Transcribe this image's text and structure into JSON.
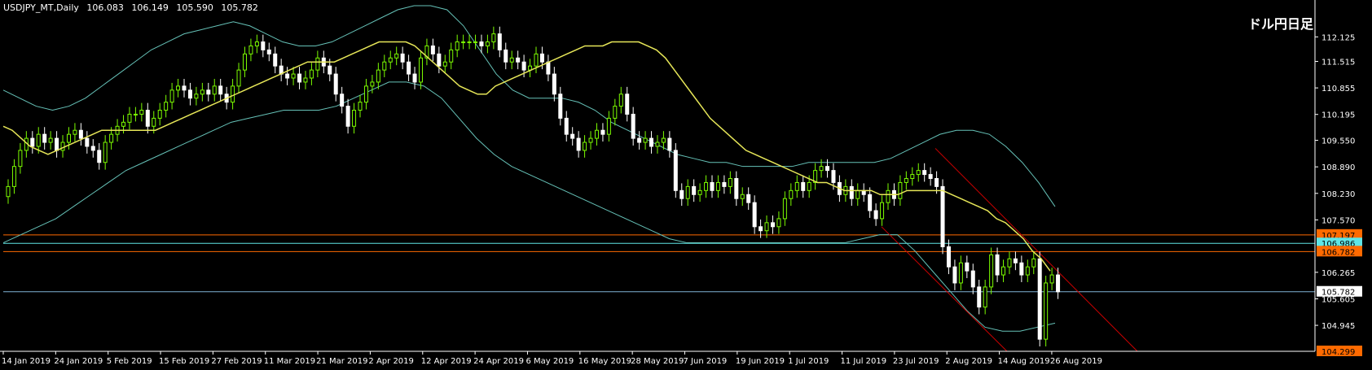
{
  "header": {
    "symbol": "USDJPY_MT,Daily",
    "open": "106.083",
    "high": "106.149",
    "low": "105.590",
    "close": "105.782"
  },
  "title_jp": "ドル円日足",
  "colors": {
    "background": "#000000",
    "bull_candle": "#7CFC00",
    "bear_candle": "#FFFFFF",
    "ma_line": "#E6E658",
    "bands": "#66C2B8",
    "orange_line": "#FF6A00",
    "cyan_line": "#5FE6E6",
    "channel": "#CC0000",
    "axis": "#FFFFFF"
  },
  "chart_data": {
    "type": "candlestick",
    "ylim": [
      104.299,
      112.8
    ],
    "y_ticks": [
      "112.125",
      "111.515",
      "110.855",
      "110.195",
      "109.550",
      "108.890",
      "108.230",
      "107.570",
      "106.265",
      "105.605",
      "104.945"
    ],
    "x_ticks": [
      "14 Jan 2019",
      "24 Jan 2019",
      "5 Feb 2019",
      "15 Feb 2019",
      "27 Feb 2019",
      "11 Mar 2019",
      "21 Mar 2019",
      "2 Apr 2019",
      "12 Apr 2019",
      "24 Apr 2019",
      "6 May 2019",
      "16 May 2019",
      "28 May 2019",
      "7 Jun 2019",
      "19 Jun 2019",
      "1 Jul 2019",
      "11 Jul 2019",
      "23 Jul 2019",
      "2 Aug 2019",
      "14 Aug 2019",
      "26 Aug 2019"
    ],
    "price_labels": [
      {
        "value": 107.197,
        "label": "107.197",
        "bg": "#FF6A00",
        "fg": "#000000"
      },
      {
        "value": 106.986,
        "label": "106.986",
        "bg": "#5FE6E6",
        "fg": "#000000"
      },
      {
        "value": 106.782,
        "label": "106.782",
        "bg": "#FF6A00",
        "fg": "#000000"
      },
      {
        "value": 105.782,
        "label": "105.782",
        "bg": "#FFFFFF",
        "fg": "#000000"
      },
      {
        "value": 104.299,
        "label": "104.299",
        "bg": "#FF6A00",
        "fg": "#000000"
      }
    ],
    "h_lines": [
      {
        "value": 107.197,
        "color": "#FF6A00"
      },
      {
        "value": 106.986,
        "color": "#5FE6E6"
      },
      {
        "value": 106.782,
        "color": "#FF6A00"
      },
      {
        "value": 105.782,
        "color": "#7FB3D5"
      },
      {
        "value": 104.299,
        "color": "#FF6A00"
      }
    ],
    "closes": [
      108.4,
      108.9,
      109.3,
      109.6,
      109.4,
      109.7,
      109.5,
      109.6,
      109.3,
      109.5,
      109.7,
      109.8,
      109.6,
      109.4,
      109.3,
      109.0,
      109.5,
      109.7,
      109.9,
      110.0,
      110.2,
      110.2,
      110.3,
      109.9,
      110.1,
      110.3,
      110.5,
      110.8,
      110.9,
      110.8,
      110.6,
      110.7,
      110.8,
      110.7,
      110.9,
      110.7,
      110.5,
      110.9,
      111.3,
      111.7,
      111.9,
      112.0,
      111.8,
      111.7,
      111.4,
      111.2,
      111.1,
      111.2,
      111.0,
      111.1,
      111.3,
      111.6,
      111.4,
      111.2,
      110.7,
      110.4,
      109.9,
      110.3,
      110.5,
      110.9,
      111.0,
      111.3,
      111.5,
      111.6,
      111.7,
      111.5,
      111.2,
      111.0,
      111.6,
      111.9,
      111.7,
      111.4,
      111.5,
      111.8,
      112.0,
      112.0,
      112.0,
      112.0,
      111.9,
      112.0,
      112.2,
      111.8,
      111.5,
      111.6,
      111.5,
      111.3,
      111.4,
      111.7,
      111.5,
      111.2,
      110.7,
      110.1,
      109.7,
      109.6,
      109.3,
      109.5,
      109.6,
      109.8,
      109.7,
      110.1,
      110.4,
      110.7,
      110.2,
      109.6,
      109.5,
      109.6,
      109.4,
      109.5,
      109.6,
      109.3,
      108.3,
      108.1,
      108.4,
      108.2,
      108.3,
      108.5,
      108.3,
      108.5,
      108.4,
      108.6,
      108.1,
      108.2,
      108.0,
      107.4,
      107.3,
      107.5,
      107.4,
      107.6,
      108.1,
      108.3,
      108.5,
      108.3,
      108.5,
      108.8,
      108.9,
      108.8,
      108.5,
      108.2,
      108.4,
      108.1,
      108.3,
      108.2,
      107.8,
      107.6,
      108.0,
      108.3,
      108.1,
      108.5,
      108.6,
      108.7,
      108.8,
      108.7,
      108.6,
      108.4,
      106.9,
      106.4,
      106.0,
      106.5,
      106.3,
      105.9,
      105.4,
      105.9,
      106.7,
      106.2,
      106.4,
      106.6,
      106.5,
      106.2,
      106.4,
      106.6,
      104.6,
      106.0,
      106.2,
      105.78
    ],
    "ma": [
      109.9,
      109.8,
      109.6,
      109.4,
      109.3,
      109.2,
      109.3,
      109.4,
      109.5,
      109.6,
      109.7,
      109.8,
      109.8,
      109.8,
      109.8,
      109.8,
      109.8,
      109.8,
      109.9,
      110.0,
      110.1,
      110.2,
      110.3,
      110.4,
      110.5,
      110.6,
      110.7,
      110.8,
      110.9,
      111.0,
      111.1,
      111.2,
      111.3,
      111.4,
      111.5,
      111.5,
      111.5,
      111.5,
      111.6,
      111.7,
      111.8,
      111.9,
      112.0,
      112.0,
      112.0,
      112.0,
      111.9,
      111.7,
      111.5,
      111.3,
      111.1,
      110.9,
      110.8,
      110.7,
      110.7,
      110.9,
      111.0,
      111.1,
      111.2,
      111.3,
      111.4,
      111.5,
      111.6,
      111.7,
      111.8,
      111.9,
      111.9,
      111.9,
      112.0,
      112.0,
      112.0,
      112.0,
      111.9,
      111.8,
      111.6,
      111.3,
      111.0,
      110.7,
      110.4,
      110.1,
      109.9,
      109.7,
      109.5,
      109.3,
      109.2,
      109.1,
      109.0,
      108.9,
      108.8,
      108.7,
      108.6,
      108.5,
      108.5,
      108.4,
      108.3,
      108.3,
      108.3,
      108.3,
      108.2,
      108.2,
      108.2,
      108.3,
      108.3,
      108.3,
      108.3,
      108.3,
      108.2,
      108.1,
      108.0,
      107.9,
      107.8,
      107.6,
      107.5,
      107.3,
      107.1,
      106.8,
      106.6,
      106.3
    ],
    "ma_start_index": 0,
    "upper_band": [
      110.8,
      110.6,
      110.4,
      110.3,
      110.4,
      110.6,
      110.9,
      111.2,
      111.5,
      111.8,
      112.0,
      112.2,
      112.3,
      112.4,
      112.5,
      112.4,
      112.2,
      112.0,
      111.9,
      111.9,
      112.0,
      112.2,
      112.4,
      112.6,
      112.8,
      112.9,
      112.9,
      112.8,
      112.4,
      111.8,
      111.2,
      110.8,
      110.6,
      110.6,
      110.6,
      110.5,
      110.3,
      110.0,
      109.8,
      109.6,
      109.4,
      109.2,
      109.1,
      109.0,
      109.0,
      108.9,
      108.9,
      108.9,
      108.9,
      109.0,
      109.0,
      109.0,
      109.0,
      109.0,
      109.1,
      109.3,
      109.5,
      109.7,
      109.8,
      109.8,
      109.7,
      109.4,
      109.0,
      108.5,
      107.9
    ],
    "upper_band_x0": 0,
    "lower_band": [
      107.0,
      107.2,
      107.4,
      107.6,
      107.9,
      108.2,
      108.5,
      108.8,
      109.0,
      109.2,
      109.4,
      109.6,
      109.8,
      110.0,
      110.1,
      110.2,
      110.3,
      110.3,
      110.3,
      110.4,
      110.6,
      110.8,
      111.0,
      111.0,
      110.9,
      110.6,
      110.1,
      109.6,
      109.2,
      108.9,
      108.7,
      108.5,
      108.3,
      108.1,
      107.9,
      107.7,
      107.5,
      107.3,
      107.1,
      107.0,
      107.0,
      107.0,
      107.0,
      107.0,
      107.0,
      107.0,
      107.0,
      107.0,
      107.0,
      107.1,
      107.2,
      107.2,
      106.8,
      106.3,
      105.8,
      105.3,
      104.9,
      104.8,
      104.8,
      104.9,
      105.0
    ]
  }
}
